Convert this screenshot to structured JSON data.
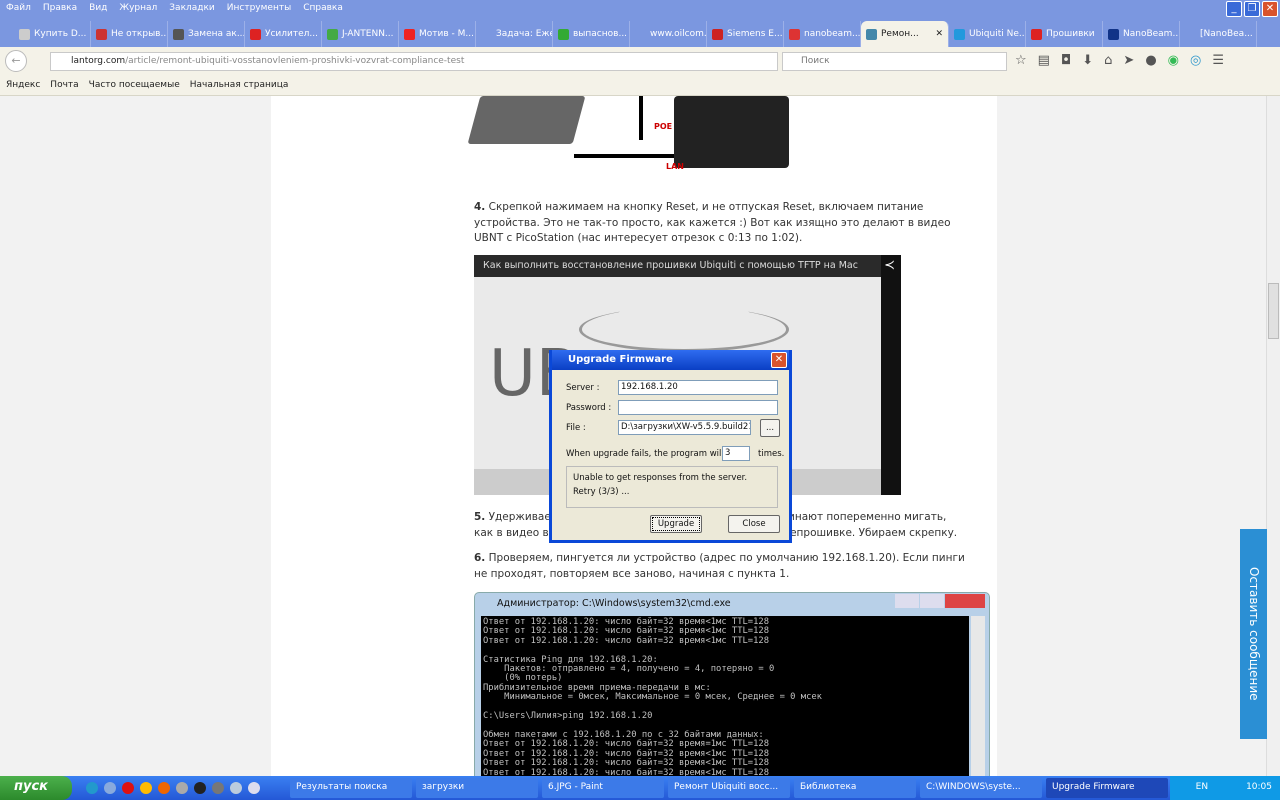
{
  "menu": [
    "Файл",
    "Правка",
    "Вид",
    "Журнал",
    "Закладки",
    "Инструменты",
    "Справка"
  ],
  "tabs": [
    {
      "label": "Купить D...",
      "color": "#ccc"
    },
    {
      "label": "Не открыв...",
      "color": "#c33"
    },
    {
      "label": "Замена ак...",
      "color": "#555"
    },
    {
      "label": "Усилител...",
      "color": "#d22"
    },
    {
      "label": "J-ANTENN...",
      "color": "#4a4"
    },
    {
      "label": "Мотив - М...",
      "color": "#e22"
    },
    {
      "label": "Задача: Ежен...",
      "color": "#7b97e0"
    },
    {
      "label": "выпаснов...",
      "color": "#3a3"
    },
    {
      "label": "www.oilcom.sp...",
      "color": "#7b97e0"
    },
    {
      "label": "Siemens E...",
      "color": "#c22"
    },
    {
      "label": "nanobeam...",
      "color": "#d33"
    },
    {
      "label": "Ремон...",
      "color": "#48a",
      "active": true
    },
    {
      "label": "Ubiquiti Ne...",
      "color": "#29d"
    },
    {
      "label": "Прошивки",
      "color": "#d22"
    },
    {
      "label": "NanoBeam...",
      "color": "#138"
    },
    {
      "label": "[NanoBea...",
      "color": "#7b97e0"
    }
  ],
  "nav": {
    "url_host": "lantorg.com",
    "url_path": "/article/remont-ubiquiti-vosstanovleniem-proshivki-vozvrat-compliance-test",
    "search_placeholder": "Поиск"
  },
  "bookmarks": [
    "Яндекс",
    "Почта",
    "Часто посещаемые",
    "Начальная страница"
  ],
  "article": {
    "router_labels": {
      "poe": "POE",
      "lan": "LAN"
    },
    "step4_num": "4.",
    "step4": " Скрепкой нажимаем на кнопку Reset, и не отпуская Reset, включаем питание устройства. Это не так-то просто, как кажется :) Вот как изящно это делают в видео UBNT с PicoStation (нас интересует отрезок с 0:13 по 1:02).",
    "video_title": "Как выполнить восстановление прошивки Ubiquiti с помощью TFTP на Mac",
    "video_logo": "UB",
    "step5_num": "5.",
    "step5_a": " Удерживаем",
    "step5_b": "е начинают попеременно мигать,",
    "step5_c": "как в видео вы",
    "step5_d": "ерепрошивке. Убираем скрепку.",
    "step6_num": "6.",
    "step6": " Проверяем, пингуется ли устройство (адрес по умолчанию 192.168.1.20). Если пинги не проходят, повторяем все заново, начиная с пункта 1."
  },
  "dialog": {
    "title": "Upgrade Firmware",
    "server_label": "Server    :",
    "server": "192.168.1.20",
    "password_label": "Password :",
    "password": "",
    "file_label": "File       :",
    "file": "D:\\загрузки\\XW-v5.5.9.build2173",
    "browse": "...",
    "retry_text": "When upgrade fails, the program will retry",
    "retry_count": "3",
    "times": "times.",
    "status1": "Unable to get responses from the server.",
    "status2": "Retry (3/3) ...",
    "upgrade": "Upgrade",
    "close": "Close"
  },
  "cmd": {
    "title": "Администратор: C:\\Windows\\system32\\cmd.exe",
    "output": "Ответ от 192.168.1.20: число байт=32 время<1мс TTL=128\nОтвет от 192.168.1.20: число байт=32 время<1мс TTL=128\nОтвет от 192.168.1.20: число байт=32 время<1мс TTL=128\n\nСтатистика Ping для 192.168.1.20:\n    Пакетов: отправлено = 4, получено = 4, потеряно = 0\n    (0% потерь)\nПриблизительное время приема-передачи в мс:\n    Минимальное = 0мсек, Максимальное = 0 мсек, Среднее = 0 мсек\n\nC:\\Users\\Лилия>ping 192.168.1.20\n\nОбмен пакетами с 192.168.1.20 по с 32 байтами данных:\nОтвет от 192.168.1.20: число байт=32 время=1мс TTL=128\nОтвет от 192.168.1.20: число байт=32 время<1мс TTL=128\nОтвет от 192.168.1.20: число байт=32 время<1мс TTL=128\nОтвет от 192.168.1.20: число байт=32 время<1мс TTL=128"
  },
  "feedback": "Оставить сообщение",
  "taskbar": {
    "start": "пуск",
    "tasks": [
      "Результаты поиска",
      "загрузки",
      "6.JPG - Paint",
      "Ремонт Ubiquiti восс...",
      "Библиотека",
      "C:\\WINDOWS\\syste...",
      "Upgrade Firmware"
    ],
    "lang": "EN",
    "clock": "10:05"
  }
}
